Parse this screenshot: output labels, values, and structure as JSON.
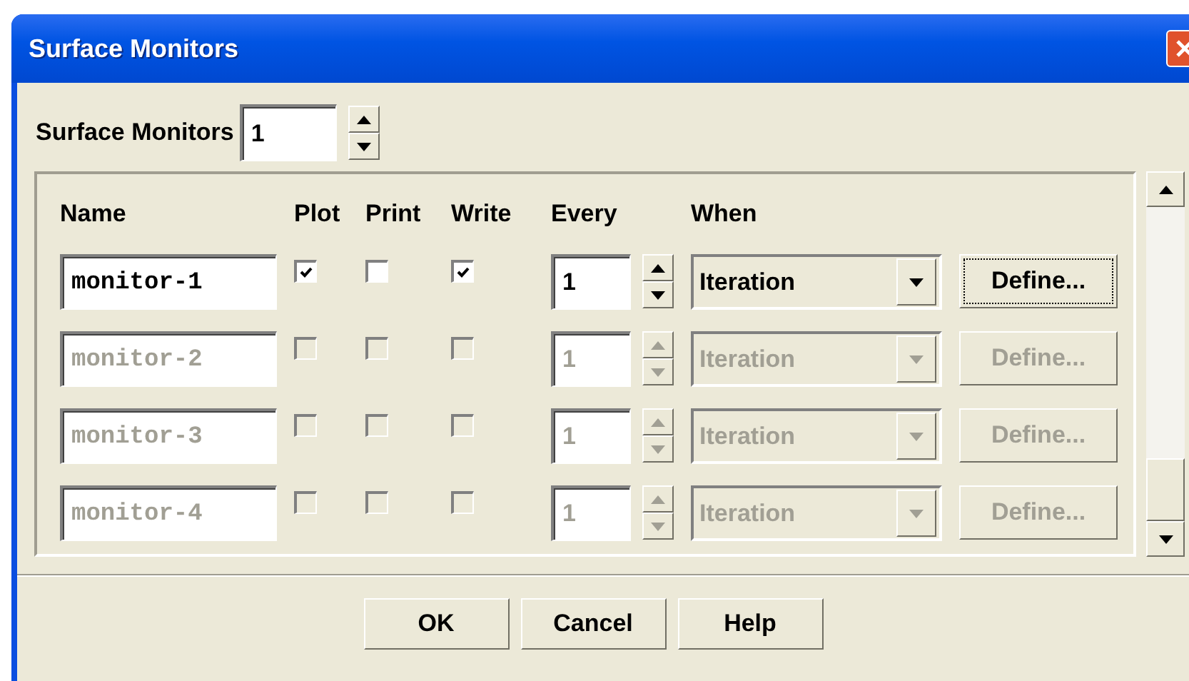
{
  "window": {
    "title": "Surface Monitors"
  },
  "count": {
    "label": "Surface Monitors",
    "value": "1"
  },
  "columns": [
    "Name",
    "Plot",
    "Print",
    "Write",
    "Every",
    "When"
  ],
  "monitors": [
    {
      "name": "monitor-1",
      "enabled": true,
      "plot": true,
      "print": false,
      "write": true,
      "every": "1",
      "when": "Iteration",
      "define": "Define...",
      "focused": true
    },
    {
      "name": "monitor-2",
      "enabled": false,
      "plot": false,
      "print": false,
      "write": false,
      "every": "1",
      "when": "Iteration",
      "define": "Define...",
      "focused": false
    },
    {
      "name": "monitor-3",
      "enabled": false,
      "plot": false,
      "print": false,
      "write": false,
      "every": "1",
      "when": "Iteration",
      "define": "Define...",
      "focused": false
    },
    {
      "name": "monitor-4",
      "enabled": false,
      "plot": false,
      "print": false,
      "write": false,
      "every": "1",
      "when": "Iteration",
      "define": "Define...",
      "focused": false
    }
  ],
  "buttons": [
    "OK",
    "Cancel",
    "Help"
  ]
}
